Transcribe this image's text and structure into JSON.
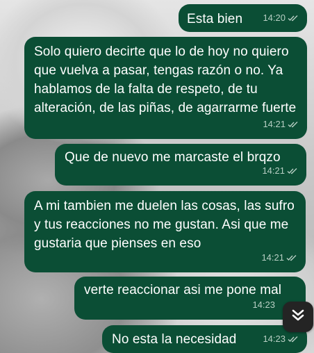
{
  "messages": [
    {
      "text": "Esta bien",
      "time": "14:20"
    },
    {
      "text": "Solo quiero decirte que lo de hoy no quiero que vuelva a pasar, tengas razón o no. Ya hablamos de la falta de respeto, de tu alteración, de las piñas, de agarrarme fuerte",
      "time": "14:21"
    },
    {
      "text": "Que de nuevo me marcaste el brqzo",
      "time": "14:21"
    },
    {
      "text": "A mi tambien me duelen las cosas, las sufro y tus reacciones no me gustan. Asi que me gustaria que pienses en eso",
      "time": "14:21"
    },
    {
      "text": "verte reaccionar asi me pone mal",
      "time": "14:23"
    },
    {
      "text": "No esta la necesidad",
      "time": "14:23"
    }
  ],
  "icons": {
    "read_receipt": "double-check-icon",
    "scroll_down": "double-chevron-down-icon"
  },
  "colors": {
    "bubble": "#0b4e35",
    "text": "#ffffff",
    "meta": "#b8cfc4"
  }
}
